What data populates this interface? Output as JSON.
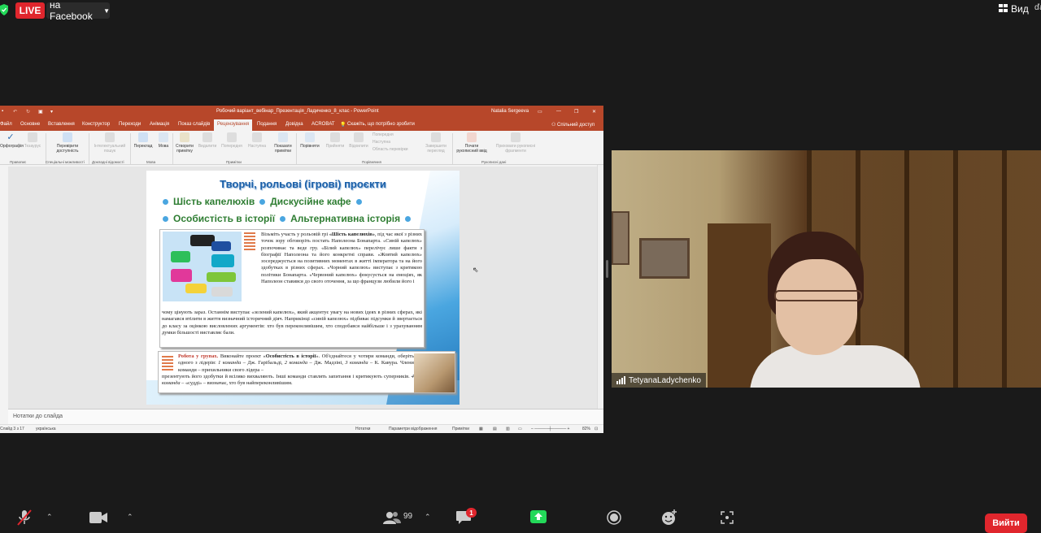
{
  "topbar": {
    "live_label": "LIVE",
    "facebook_label": "на Facebook",
    "view_label": "Вид",
    "view_extra": "ďą"
  },
  "ppt": {
    "title": "Робочий варіант_вебінар_Презентація_Ладиченко_8_клас  -  PowerPoint",
    "user": "Natalia Sergeeva",
    "tabs": [
      "Файл",
      "Основне",
      "Вставлення",
      "Конструктор",
      "Переходи",
      "Анімація",
      "Показ слайдів",
      "Рецензування",
      "Подання",
      "Довідка",
      "ACROBAT"
    ],
    "active_tab": "Рецензування",
    "tell_me": "Скажіть, що потрібно зробити",
    "share": "Спільний доступ",
    "ribbon": {
      "spelling": "Орфографія",
      "thesaurus": "Тезаурус",
      "check_accessibility": "Перевірити доступність",
      "smart_lookup": "Інтелектуальний пошук",
      "translate": "Переклад",
      "language": "Мова",
      "new_comment": "Створити примітку",
      "delete": "Видалити",
      "previous": "Попередня",
      "next": "Наступна",
      "show_comments": "Показати примітки",
      "compare": "Порівняти",
      "accept": "Прийняти",
      "reject": "Відхилити",
      "prev_change": "Попередня",
      "next_change": "Наступна",
      "review_pane": "Область перевірки",
      "end_review": "Завершити перегляд",
      "start_inking": "Почати рукописний ввід",
      "hide_ink": "Приховати рукописні фрагменти",
      "groups": [
        "Правопис",
        "Спеціальні можливості",
        "Докладні відомості",
        "Мова",
        "Примітки",
        "Порівняння",
        "Рукописні дані"
      ]
    },
    "notes_placeholder": "Нотатки до слайда",
    "status": {
      "slide": "Слайд 3 з 17",
      "language": "українська",
      "notes": "Нотатки",
      "display": "Параметри відображення",
      "comments": "Примітки",
      "zoom": "82%"
    }
  },
  "slide": {
    "title": "Творчі, рольові (ігрові) проєкти",
    "row1": [
      "Шість капелюхів",
      "Дискусійне кафе"
    ],
    "row2": [
      "Особистість в історії",
      "Альтернативна історія"
    ],
    "tb1_top_bold": "«Шість капелюхів»",
    "tb1_top_pre": "Візьміть участь у рольовій грі ",
    "tb1_top_post": ", під час якої з різних точок зору обговоріть постать Наполеона Бонапарта. «Синій капелюх» розпочинає та веде гру. «Білий капелюх» перелічує лише факти з біографії Наполеона та його конкретні справи. «Жовтий капелюх» зосереджується на позитивних моментах в житті імператора та на його здобутках в різних сферах. «Чорний капелюх» виступає з критикою політики Бонапарта. «Червоний капелюх» фокусується на емоціях, як Наполеон ставився до свого оточення, за що французи любили його і",
    "tb1_bottom": "чому цінують зараз. Останнім виступає «зелений капелюх», який акцентує увагу на нових ідеях в різних сферах, які намагався втілити в життя визначний історичний діяч. Наприкінці «синій капелюх» підбиває підсумки й звертається до класу за оцінкою висловлених аргументів: хто був переконливішим, хто сподобався найбільше і з урахуванням думки більшості виставляє бали.",
    "tb2_label": "Робота у групах.",
    "tb2_pre": " Виконайте проект «",
    "tb2_bold": "Особистість в історії",
    "tb2_post": "». Об'єднайтеся у чотири команди, оберіть одного з лідерів: ",
    "tb2_t1": "1 команда",
    "tb2_t1n": " – Дж. Гарібальді, ",
    "tb2_t2": "2 команда",
    "tb2_t2n": " – Дж. Мадзіні, ",
    "tb2_t3": "3 команда",
    "tb2_t3n": " – К. Кавура. Члени команди – прихильники свого лідера –",
    "tb2_bottom_pre": "презентують його здобутки й всіляко вихваляють. Інші команди ставлять запитання і критикують суперників. ",
    "tb2_t4": "4 команда",
    "tb2_bottom_post": " – «судді» – визначає, хто був найпереконливішим."
  },
  "video": {
    "participant_name": "TetyanaLadychenko"
  },
  "toolbar": {
    "participants_count": "99",
    "chat_badge": "1",
    "leave_label": "Вийти"
  },
  "colors": {
    "zoom_red": "#e0262d",
    "ppt_accent": "#b7472a",
    "share_green": "#23d959",
    "slide_title": "#1a5fa8",
    "slide_bullets": "#2e7d32"
  }
}
